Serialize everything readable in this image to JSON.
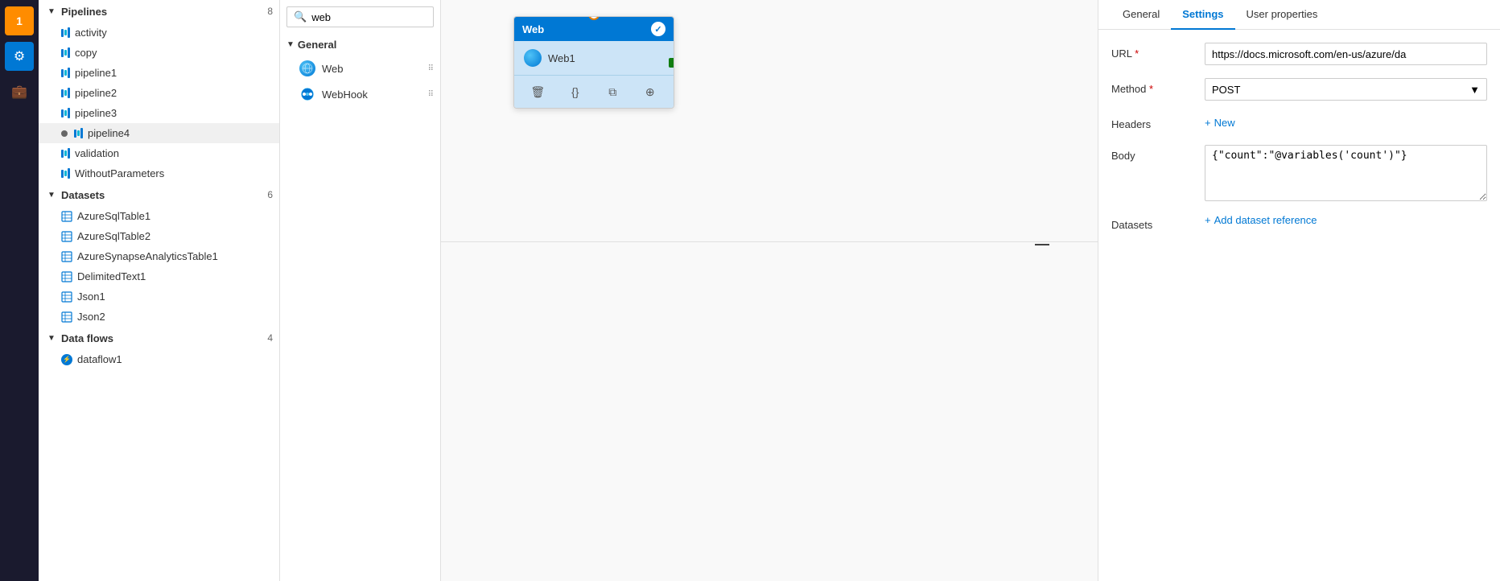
{
  "sidebar": {
    "icons": [
      {
        "name": "orange-icon",
        "label": "1",
        "type": "orange"
      },
      {
        "name": "monitor-icon",
        "label": "⚙",
        "type": "active"
      },
      {
        "name": "briefcase-icon",
        "label": "💼",
        "type": "normal"
      }
    ]
  },
  "pipeline_panel": {
    "pipelines": {
      "header": "Pipelines",
      "count": "8",
      "items": [
        {
          "label": "activity"
        },
        {
          "label": "copy"
        },
        {
          "label": "pipeline1"
        },
        {
          "label": "pipeline2"
        },
        {
          "label": "pipeline3"
        },
        {
          "label": "pipeline4",
          "active": true,
          "dot": true
        },
        {
          "label": "validation"
        },
        {
          "label": "WithoutParameters"
        }
      ]
    },
    "datasets": {
      "header": "Datasets",
      "count": "6",
      "items": [
        {
          "label": "AzureSqlTable1"
        },
        {
          "label": "AzureSqlTable2"
        },
        {
          "label": "AzureSynapseAnalyticsTable1"
        },
        {
          "label": "DelimitedText1"
        },
        {
          "label": "Json1"
        },
        {
          "label": "Json2"
        }
      ]
    },
    "dataflows": {
      "header": "Data flows",
      "count": "4",
      "items": [
        {
          "label": "dataflow1"
        }
      ]
    }
  },
  "activities_panel": {
    "search_placeholder": "web",
    "general_header": "General",
    "items": [
      {
        "label": "Web",
        "type": "web"
      },
      {
        "label": "WebHook",
        "type": "webhook"
      }
    ]
  },
  "canvas": {
    "node": {
      "header": "Web",
      "body_label": "Web1",
      "actions": [
        "delete",
        "code",
        "copy",
        "link"
      ]
    }
  },
  "settings_panel": {
    "tabs": [
      {
        "label": "General"
      },
      {
        "label": "Settings",
        "active": true
      },
      {
        "label": "User properties"
      }
    ],
    "fields": {
      "url_label": "URL",
      "url_required": "*",
      "url_value": "https://docs.microsoft.com/en-us/azure/da",
      "method_label": "Method",
      "method_required": "*",
      "method_value": "POST",
      "headers_label": "Headers",
      "headers_new": "New",
      "body_label": "Body",
      "body_value": "{\"count\":\"@variables('count')\"}",
      "datasets_label": "Datasets",
      "add_dataset": "Add dataset reference"
    }
  }
}
